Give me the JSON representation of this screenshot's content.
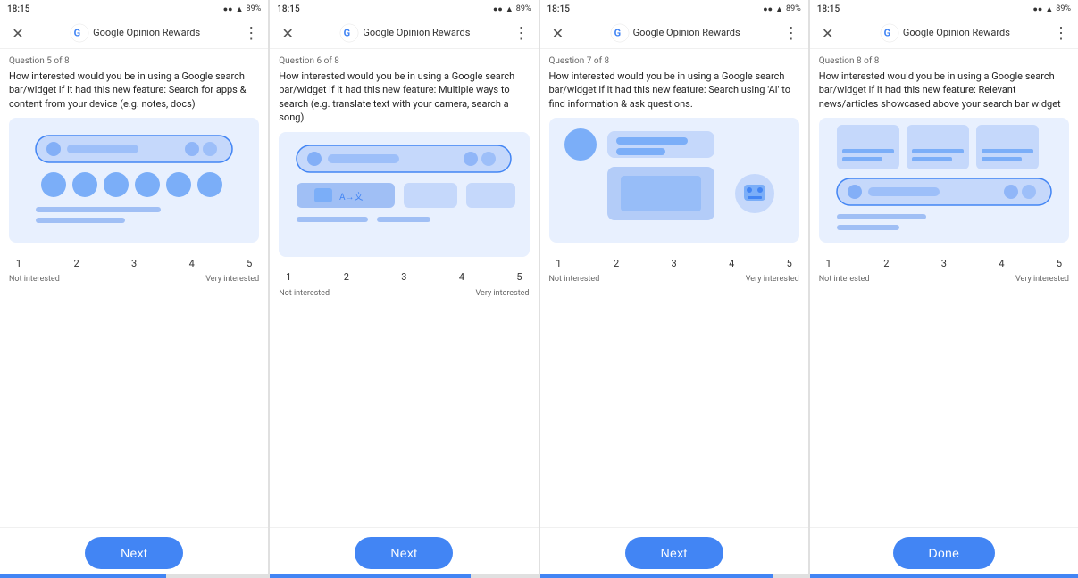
{
  "screens": [
    {
      "id": "screen1",
      "status": {
        "time": "18:15",
        "battery": "89%"
      },
      "header": {
        "app_name": "Google Opinion Rewards",
        "close_label": "×",
        "menu_label": "⋮"
      },
      "question_label": "Question 5 of 8",
      "question_text": "How interested would you be in using a Google search bar/widget if it had this new feature: Search for apps &amp; content from your device (e.g. notes, docs)",
      "scale": {
        "numbers": [
          "1",
          "2",
          "3",
          "4",
          "5"
        ],
        "not_interested": "Not interested",
        "very_interested": "Very interested"
      },
      "button_label": "Next",
      "button_type": "next",
      "progress": 62
    },
    {
      "id": "screen2",
      "status": {
        "time": "18:15",
        "battery": "89%"
      },
      "header": {
        "app_name": "Google Opinion Rewards",
        "close_label": "×",
        "menu_label": "⋮"
      },
      "question_label": "Question 6 of 8",
      "question_text": "How interested would you be in using a Google search bar/widget if it had this new feature: Multiple ways to search (e.g. translate text with your camera, search a song)",
      "scale": {
        "numbers": [
          "1",
          "2",
          "3",
          "4",
          "5"
        ],
        "not_interested": "Not interested",
        "very_interested": "Very interested"
      },
      "button_label": "Next",
      "button_type": "next",
      "progress": 75
    },
    {
      "id": "screen3",
      "status": {
        "time": "18:15",
        "battery": "89%"
      },
      "header": {
        "app_name": "Google Opinion Rewards",
        "close_label": "×",
        "menu_label": "⋮"
      },
      "question_label": "Question 7 of 8",
      "question_text": "How interested would you be in using a Google search bar/widget if it had this new feature: Search using 'AI' to find information &amp; ask questions.",
      "scale": {
        "numbers": [
          "1",
          "2",
          "3",
          "4",
          "5"
        ],
        "not_interested": "Not interested",
        "very_interested": "Very interested"
      },
      "button_label": "Next",
      "button_type": "next",
      "progress": 87
    },
    {
      "id": "screen4",
      "status": {
        "time": "18:15",
        "battery": "89%"
      },
      "header": {
        "app_name": "Google Opinion Rewards",
        "close_label": "×",
        "menu_label": "⋮"
      },
      "question_label": "Question 8 of 8",
      "question_text": "How interested would you be in using a Google search bar/widget if it had this new feature: Relevant news/articles showcased above your search bar widget",
      "scale": {
        "numbers": [
          "1",
          "2",
          "3",
          "4",
          "5"
        ],
        "not_interested": "Not interested",
        "very_interested": "Very interested"
      },
      "button_label": "Done",
      "button_type": "done",
      "progress": 100
    }
  ]
}
